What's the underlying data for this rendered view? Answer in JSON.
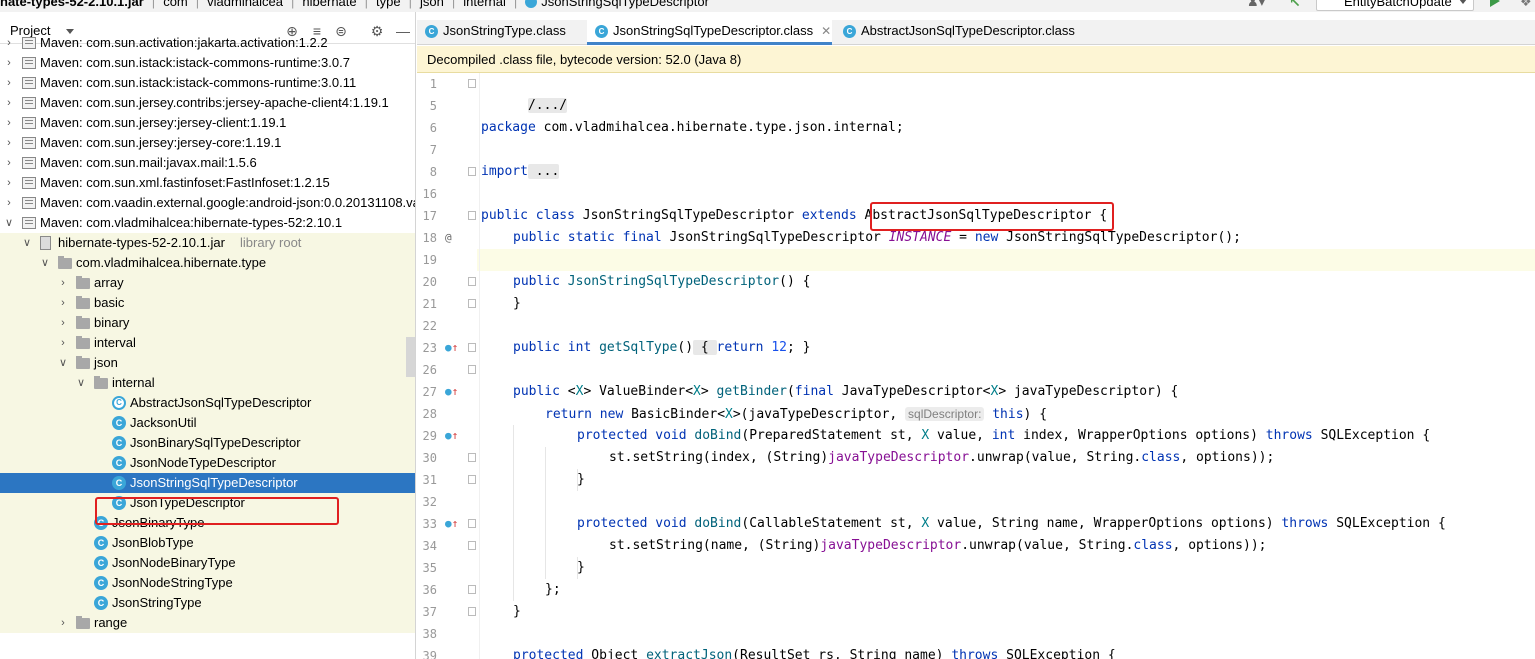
{
  "breadcrumbs": [
    "nate-types-52-2.10.1.jar",
    "com",
    "vladmihalcea",
    "hibernate",
    "type",
    "json",
    "internal",
    "JsonStringSqlTypeDescriptor"
  ],
  "toolbar": {
    "run_config": "EntityBatchUpdate"
  },
  "project_panel": {
    "title": "Project",
    "tree": [
      {
        "label": "Maven: com.sun.activation:jakarta.activation:1.2.2",
        "type": "maven"
      },
      {
        "label": "Maven: com.sun.istack:istack-commons-runtime:3.0.7",
        "type": "maven"
      },
      {
        "label": "Maven: com.sun.istack:istack-commons-runtime:3.0.11",
        "type": "maven"
      },
      {
        "label": "Maven: com.sun.jersey.contribs:jersey-apache-client4:1.19.1",
        "type": "maven"
      },
      {
        "label": "Maven: com.sun.jersey:jersey-client:1.19.1",
        "type": "maven"
      },
      {
        "label": "Maven: com.sun.jersey:jersey-core:1.19.1",
        "type": "maven"
      },
      {
        "label": "Maven: com.sun.mail:javax.mail:1.5.6",
        "type": "maven"
      },
      {
        "label": "Maven: com.sun.xml.fastinfoset:FastInfoset:1.2.15",
        "type": "maven"
      },
      {
        "label": "Maven: com.vaadin.external.google:android-json:0.0.20131108.vaadin1",
        "type": "maven"
      },
      {
        "label": "Maven: com.vladmihalcea:hibernate-types-52:2.10.1",
        "type": "maven",
        "expanded": true
      },
      {
        "label": "hibernate-types-52-2.10.1.jar",
        "extra": "library root",
        "type": "jar",
        "expanded": true
      },
      {
        "label": "com.vladmihalcea.hibernate.type",
        "type": "package",
        "expanded": true
      },
      {
        "label": "array",
        "type": "package"
      },
      {
        "label": "basic",
        "type": "package"
      },
      {
        "label": "binary",
        "type": "package"
      },
      {
        "label": "interval",
        "type": "package"
      },
      {
        "label": "json",
        "type": "package",
        "expanded": true
      },
      {
        "label": "internal",
        "type": "package",
        "expanded": true
      },
      {
        "label": "AbstractJsonSqlTypeDescriptor",
        "type": "abstract"
      },
      {
        "label": "JacksonUtil",
        "type": "class"
      },
      {
        "label": "JsonBinarySqlTypeDescriptor",
        "type": "class"
      },
      {
        "label": "JsonNodeTypeDescriptor",
        "type": "class"
      },
      {
        "label": "JsonStringSqlTypeDescriptor",
        "type": "class",
        "selected": true
      },
      {
        "label": "JsonTypeDescriptor",
        "type": "class"
      },
      {
        "label": "JsonBinaryType",
        "type": "class"
      },
      {
        "label": "JsonBlobType",
        "type": "class"
      },
      {
        "label": "JsonNodeBinaryType",
        "type": "class"
      },
      {
        "label": "JsonNodeStringType",
        "type": "class"
      },
      {
        "label": "JsonStringType",
        "type": "class"
      },
      {
        "label": "range",
        "type": "package"
      }
    ]
  },
  "editor": {
    "tabs": [
      {
        "label": "JsonStringType.class",
        "active": false
      },
      {
        "label": "JsonStringSqlTypeDescriptor.class",
        "active": true
      },
      {
        "label": "AbstractJsonSqlTypeDescriptor.class",
        "active": false
      }
    ],
    "notice": "Decompiled .class file, bytecode version: 52.0 (Java 8)",
    "line_numbers": [
      "1",
      "5",
      "6",
      "7",
      "8",
      "16",
      "17",
      "18",
      "19",
      "20",
      "21",
      "22",
      "23",
      "26",
      "27",
      "28",
      "29",
      "30",
      "31",
      "32",
      "33",
      "34",
      "35",
      "36",
      "37",
      "38",
      "39"
    ],
    "code": {
      "l1": "/.../",
      "l6_kw": "package",
      "l6_rest": " com.vladmihalcea.hibernate.type.json.internal;",
      "l8_kw": "import",
      "l8_rest": " ...",
      "l17_kw": "public class",
      "l17_name": " JsonStringSqlTypeDescriptor ",
      "l17_ext": "extends",
      "l17_sp": " ",
      "l17_super": "AbstractJsonSqlTypeDescriptor",
      "l17_brace": " {",
      "l18_kw": "public static final",
      "l18_type": " JsonStringSqlTypeDescriptor ",
      "l18_field": "INSTANCE",
      "l18_eq": " = ",
      "l18_new": "new",
      "l18_rest": " JsonStringSqlTypeDescriptor();",
      "l20_kw": "public",
      "l20_sp": " ",
      "l20_name": "JsonStringSqlTypeDescriptor",
      "l20_rest": "() {",
      "l21": "}",
      "l23_kw": "public int",
      "l23_sp": " ",
      "l23_name": "getSqlType",
      "l23_paren": "()",
      "l23_open": " { ",
      "l23_ret": "return",
      "l23_sp2": " ",
      "l23_num": "12",
      "l23_close": "; }",
      "l27_kw": "public",
      "l27_a": " <",
      "l27_X1": "X",
      "l27_b": "> ValueBinder<",
      "l27_X2": "X",
      "l27_c": "> ",
      "l27_name": "getBinder",
      "l27_d": "(",
      "l27_final": "final",
      "l27_e": " JavaTypeDescriptor<",
      "l27_X3": "X",
      "l27_f": "> javaTypeDescriptor) {",
      "l28_ret": "return new",
      "l28_a": " BasicBinder<",
      "l28_X": "X",
      "l28_b": ">(javaTypeDescriptor, ",
      "l28_hint": "sqlDescriptor:",
      "l28_sp": " ",
      "l28_this": "this",
      "l28_c": ") {",
      "l29_kw": "protected void",
      "l29_sp": " ",
      "l29_name": "doBind",
      "l29_a": "(PreparedStatement st, ",
      "l29_X": "X",
      "l29_b": " value, ",
      "l29_int": "int",
      "l29_c": " index, WrapperOptions options) ",
      "l29_throws": "throws",
      "l29_d": " SQLException {",
      "l30_a": "st.setString(index, (String)",
      "l30_field": "javaTypeDescriptor",
      "l30_b": ".unwrap(value, String.",
      "l30_class": "class",
      "l30_c": ", options));",
      "l31": "}",
      "l33_kw": "protected void",
      "l33_sp": " ",
      "l33_name": "doBind",
      "l33_a": "(CallableStatement st, ",
      "l33_X": "X",
      "l33_b": " value, String name, WrapperOptions options) ",
      "l33_throws": "throws",
      "l33_c": " SQLException {",
      "l34_a": "st.setString(name, (String)",
      "l34_field": "javaTypeDescriptor",
      "l34_b": ".unwrap(value, String.",
      "l34_class": "class",
      "l34_c": ", options));",
      "l35": "}",
      "l36": "};",
      "l37": "}",
      "l39_kw": "protected",
      "l39_a": " Object ",
      "l39_name": "extractJson",
      "l39_b": "(ResultSet rs, String name) ",
      "l39_throws": "throws",
      "l39_c": " SQLException {"
    }
  }
}
